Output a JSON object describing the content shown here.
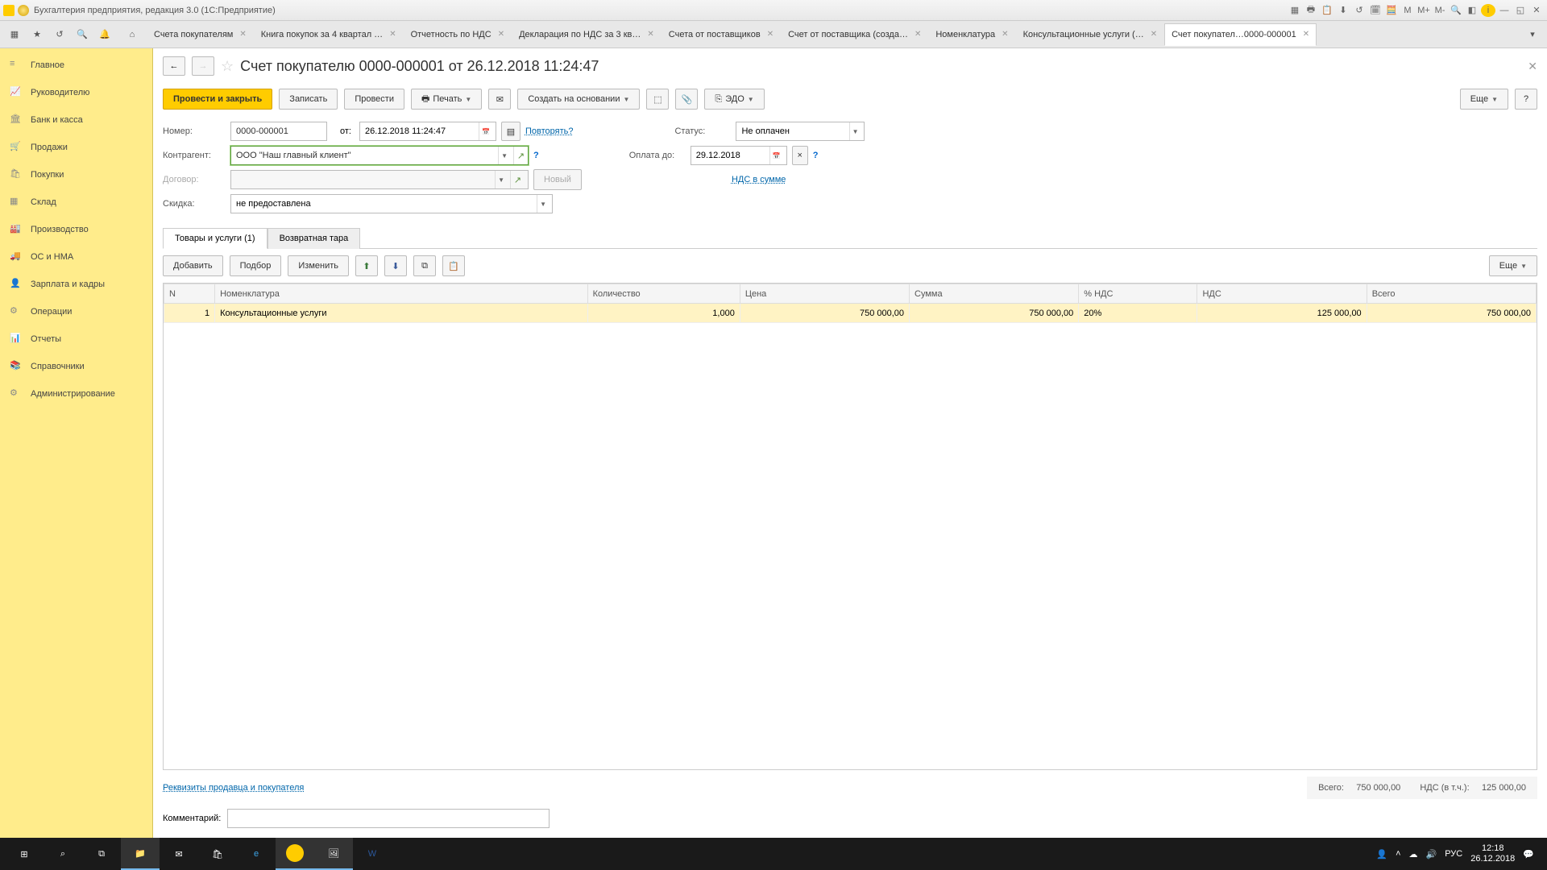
{
  "window": {
    "title": "Бухгалтерия предприятия, редакция 3.0  (1С:Предприятие)"
  },
  "top_tabs": [
    {
      "label": "Счета покупателям"
    },
    {
      "label": "Книга покупок за 4 квартал …"
    },
    {
      "label": "Отчетность по НДС"
    },
    {
      "label": "Декларация по НДС за 3 кв…"
    },
    {
      "label": "Счета от поставщиков"
    },
    {
      "label": "Счет от поставщика (созда…"
    },
    {
      "label": "Номенклатура"
    },
    {
      "label": "Консультационные услуги (…"
    },
    {
      "label": "Счет покупател…0000-000001",
      "active": true
    }
  ],
  "sidebar": [
    {
      "label": "Главное",
      "icon": "menu"
    },
    {
      "label": "Руководителю",
      "icon": "chart"
    },
    {
      "label": "Банк и касса",
      "icon": "bank"
    },
    {
      "label": "Продажи",
      "icon": "cart"
    },
    {
      "label": "Покупки",
      "icon": "basket"
    },
    {
      "label": "Склад",
      "icon": "boxes"
    },
    {
      "label": "Производство",
      "icon": "factory"
    },
    {
      "label": "ОС и НМА",
      "icon": "truck"
    },
    {
      "label": "Зарплата и кадры",
      "icon": "person"
    },
    {
      "label": "Операции",
      "icon": "ops"
    },
    {
      "label": "Отчеты",
      "icon": "report"
    },
    {
      "label": "Справочники",
      "icon": "book"
    },
    {
      "label": "Администрирование",
      "icon": "gear"
    }
  ],
  "page": {
    "title": "Счет покупателю 0000-000001 от 26.12.2018 11:24:47",
    "buttons": {
      "post_close": "Провести и закрыть",
      "write": "Записать",
      "post": "Провести",
      "print": "Печать",
      "create_based": "Создать на основании",
      "edo": "ЭДО",
      "more": "Еще"
    },
    "labels": {
      "number": "Номер:",
      "from": "от:",
      "repeat": "Повторять?",
      "status": "Статус:",
      "counterparty": "Контрагент:",
      "pay_until": "Оплата до:",
      "contract": "Договор:",
      "new": "Новый",
      "vat_in_sum": "НДС в сумме",
      "discount": "Скидка:",
      "seller_buyer": "Реквизиты продавца и покупателя",
      "comment": "Комментарий:",
      "total": "Всего:",
      "vat_incl": "НДС (в т.ч.):"
    },
    "values": {
      "number": "0000-000001",
      "date": "26.12.2018 11:24:47",
      "status": "Не оплачен",
      "counterparty": "ООО \"Наш главный клиент\"",
      "pay_until": "29.12.2018",
      "discount": "не предоставлена",
      "total": "750 000,00",
      "vat": "125 000,00"
    },
    "tabs2": [
      {
        "label": "Товары и услуги (1)",
        "active": true
      },
      {
        "label": "Возвратная тара"
      }
    ],
    "table_buttons": {
      "add": "Добавить",
      "pick": "Подбор",
      "edit": "Изменить",
      "more": "Еще"
    },
    "columns": [
      "N",
      "Номенклатура",
      "Количество",
      "Цена",
      "Сумма",
      "% НДС",
      "НДС",
      "Всего"
    ],
    "rows": [
      {
        "n": "1",
        "nom": "Консультационные услуги",
        "qty": "1,000",
        "price": "750 000,00",
        "sum": "750 000,00",
        "vatp": "20%",
        "vat": "125 000,00",
        "total": "750 000,00"
      }
    ]
  },
  "taskbar": {
    "time": "12:18",
    "date": "26.12.2018",
    "lang": "РУС"
  }
}
